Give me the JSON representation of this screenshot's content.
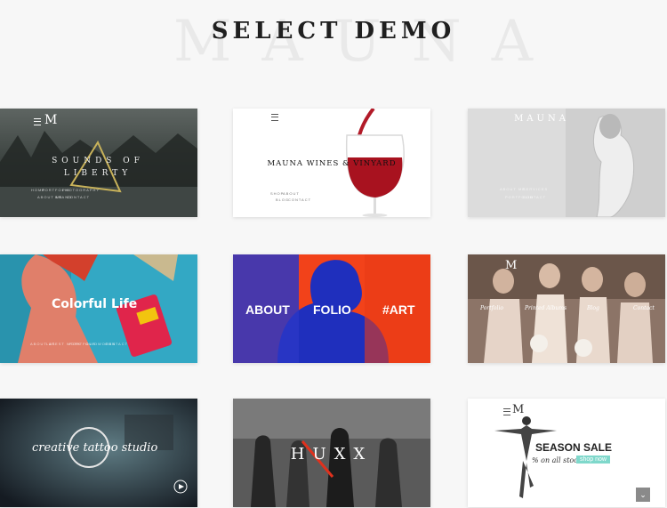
{
  "page": {
    "title": "SELECT DEMO",
    "watermark": "MAUNA"
  },
  "demos": [
    {
      "title": "SOUNDS OF LIBERTY",
      "logo": "M",
      "nav": [
        "HOME",
        "PORTFOLIO",
        "PHOTOGRAPHY",
        "ABOUT US",
        "BRAND",
        "CONTACT"
      ]
    },
    {
      "title": "MAUNA WINES & VINYARD",
      "nav": [
        "SHOP",
        "ABOUT",
        "BLOG",
        "CONTACT"
      ]
    },
    {
      "title": "MAUNA",
      "nav": [
        "ABOUT ME",
        "SERVICES",
        "PORTFOLIO",
        "CONTACT"
      ]
    },
    {
      "title": "Colorful Life",
      "nav": [
        "ABOUT US",
        "LATEST WORK",
        "PORTFOLIO",
        "OUR WORKS",
        "CONTACT"
      ]
    },
    {
      "words": [
        "ABOUT",
        "FOLIO",
        "#ART"
      ]
    },
    {
      "logo": "M",
      "nav": [
        "Portfolio",
        "Printed Albums",
        "Blog",
        "Contact"
      ]
    },
    {
      "title": "creative tattoo studio"
    },
    {
      "title": "HUXX"
    },
    {
      "logo": "M",
      "title": "SEASON SALE",
      "subtitle": "% on all stock",
      "cta": "shop now"
    }
  ],
  "scroll_top_icon": "chevron-down-icon"
}
